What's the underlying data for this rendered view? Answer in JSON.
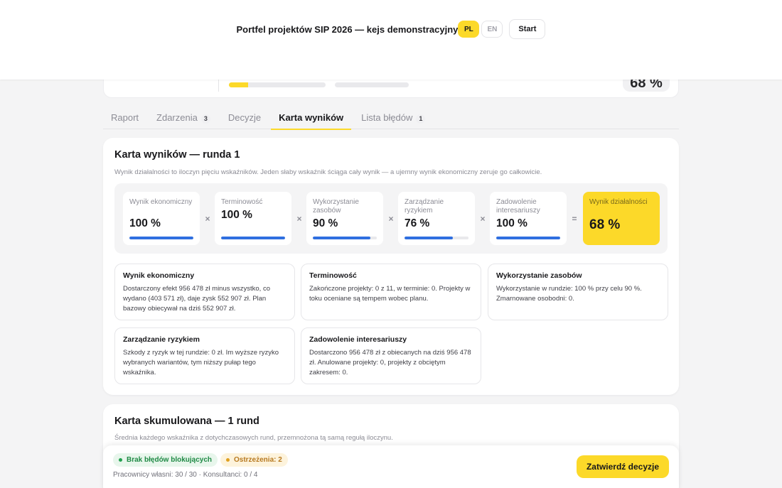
{
  "header": {
    "title": "Portfel projektów SIP 2026 — kejs demonstracyjny",
    "lang_pl": "PL",
    "lang_en": "EN",
    "start_label": "Start"
  },
  "summary": {
    "progress_primary": 0.2,
    "score_value": "68 %"
  },
  "tabs": [
    {
      "label": "Raport",
      "badge": null,
      "active": false
    },
    {
      "label": "Zdarzenia",
      "badge": "3",
      "active": false
    },
    {
      "label": "Decyzje",
      "badge": null,
      "active": false
    },
    {
      "label": "Karta wyników",
      "badge": null,
      "active": true
    },
    {
      "label": "Lista błędów",
      "badge": "1",
      "active": false
    }
  ],
  "scorecard": {
    "title": "Karta wyników — runda 1",
    "subtitle": "Wynik działalności to iloczyn pięciu wskaźników. Jeden słaby wskaźnik ściąga cały wynik — a ujemny wynik ekonomiczny zeruje go całkowicie.",
    "factors": [
      {
        "label": "Wynik ekonomiczny",
        "value": "100 %",
        "level": 1.0
      },
      {
        "label": "Terminowość",
        "value": "100 %",
        "level": 1.0
      },
      {
        "label": "Wykorzystanie zasobów",
        "value": "90 %",
        "level": 0.9
      },
      {
        "label": "Zarządzanie ryzykiem",
        "value": "76 %",
        "level": 0.76
      },
      {
        "label": "Zadowolenie interesariuszy",
        "value": "100 %",
        "level": 1.0
      }
    ],
    "operator_multiply": "×",
    "operator_equals": "=",
    "result": {
      "label": "Wynik działalności",
      "value": "68 %"
    },
    "details": [
      {
        "title": "Wynik ekonomiczny",
        "text": "Dostarczony efekt 956 478 zł minus wszystko, co wydano (403 571 zł), daje zysk 552 907 zł. Plan bazowy obiecywał na dziś 552 907 zł."
      },
      {
        "title": "Terminowość",
        "text": "Zakończone projekty: 0 z 11, w terminie: 0. Projekty w toku oceniane są tempem wobec planu."
      },
      {
        "title": "Wykorzystanie zasobów",
        "text": "Wykorzystanie w rundzie: 100 % przy celu 90 %. Zmarnowane osobodni: 0."
      },
      {
        "title": "Zarządzanie ryzykiem",
        "text": "Szkody z ryzyk w tej rundzie: 0 zł. Im wyższe ryzyko wybranych wariantów, tym niższy pułap tego wskaźnika."
      },
      {
        "title": "Zadowolenie interesariuszy",
        "text": "Dostarczono 956 478 zł z obiecanych na dziś 956 478 zł. Anulowane projekty: 0, projekty z obciętym zakresem: 0."
      }
    ]
  },
  "cumulative": {
    "title": "Karta skumulowana — 1 rund",
    "subtitle": "Średnia każdego wskaźnika z dotychczasowych rund, przemnożona tą samą regułą iloczynu."
  },
  "footer": {
    "status_ok": "Brak błędów blokujących",
    "status_warn": "Ostrzeżenia: 2",
    "resources": "Pracownicy własni: 30 / 30 · Konsultanci: 0 / 4",
    "confirm_label": "Zatwierdź decyzje"
  },
  "colors": {
    "accent": "#fcd929",
    "bar": "#2f6fe0",
    "ok": "#22a14f",
    "warn": "#e0a020"
  }
}
